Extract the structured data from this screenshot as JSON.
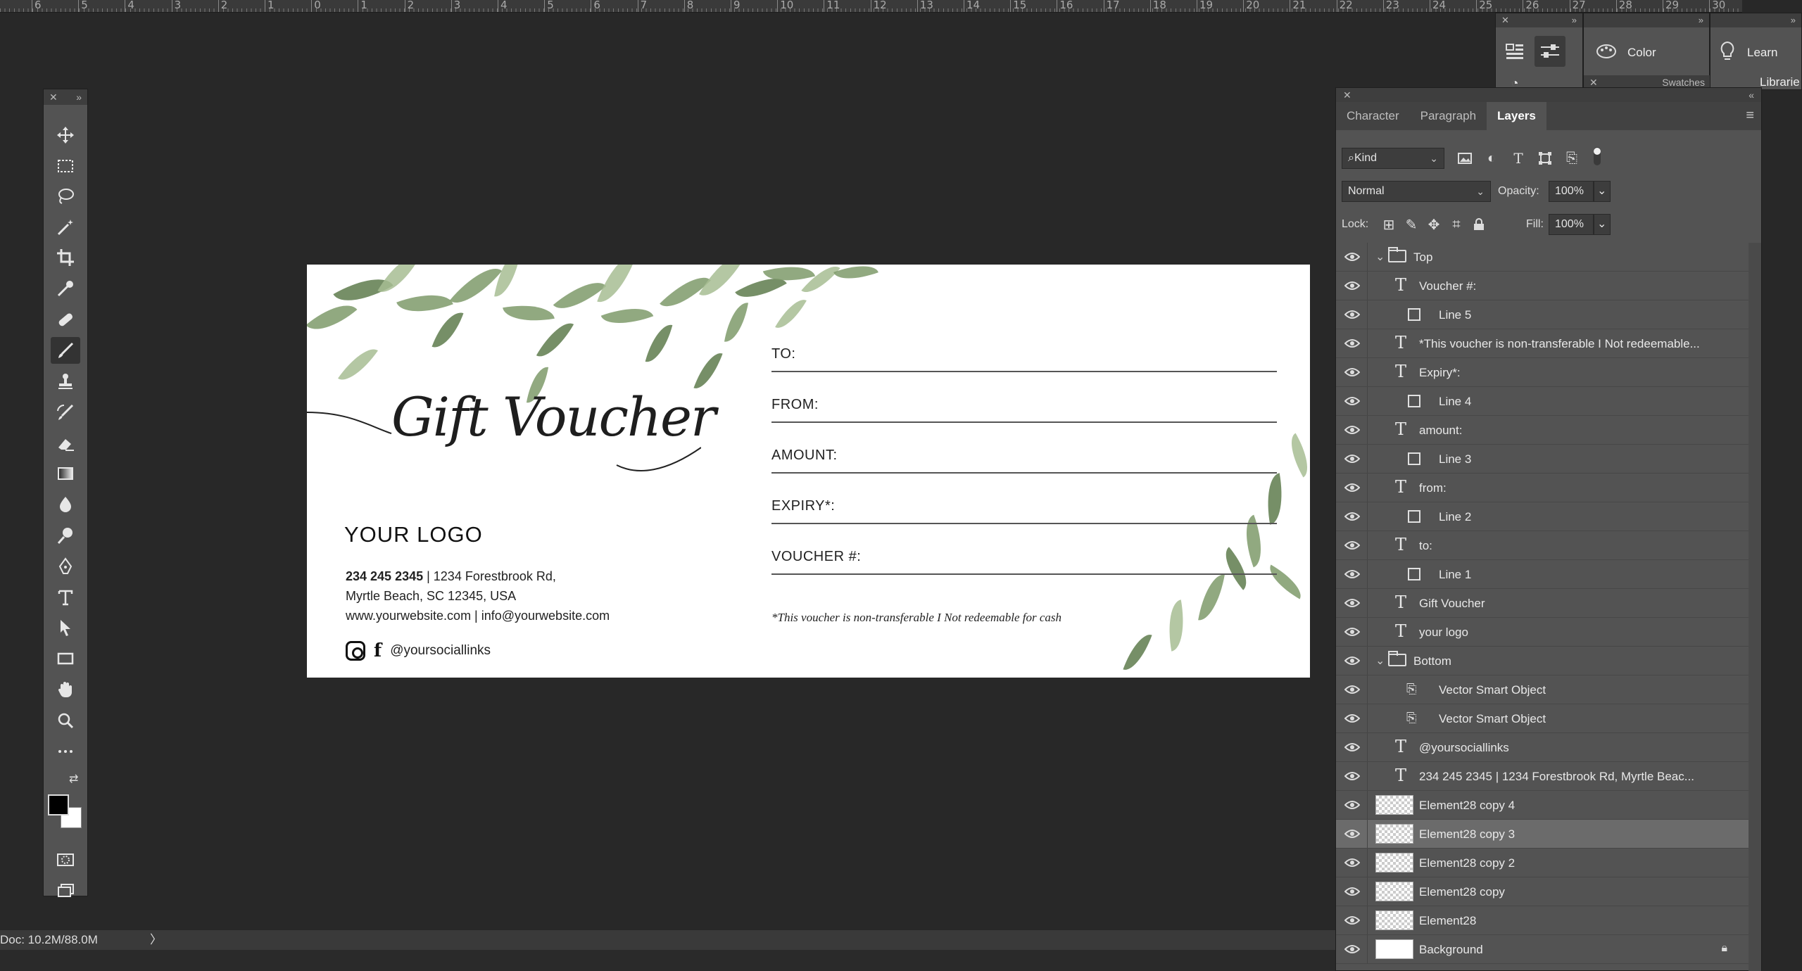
{
  "ruler": {
    "ticks": [
      "6",
      "5",
      "4",
      "3",
      "2",
      "1",
      "0",
      "1",
      "2",
      "3",
      "4",
      "5",
      "6",
      "7",
      "8",
      "9",
      "10",
      "11",
      "12",
      "13",
      "14",
      "15",
      "16",
      "17",
      "18",
      "19",
      "20",
      "21",
      "22",
      "23",
      "24",
      "25",
      "26",
      "27",
      "28",
      "29",
      "30"
    ]
  },
  "toolbar": {
    "close": "✕",
    "collapse": "»",
    "tools": [
      "move-tool",
      "marquee-tool",
      "lasso-tool",
      "magic-wand-tool",
      "crop-tool",
      "eyedropper-tool",
      "healing-brush-tool",
      "brush-tool",
      "clone-stamp-tool",
      "history-brush-tool",
      "eraser-tool",
      "gradient-tool",
      "blur-tool",
      "dodge-tool",
      "pen-tool",
      "type-tool",
      "path-selection-tool",
      "rectangle-tool",
      "hand-tool",
      "zoom-tool",
      "more-tools",
      "quick-mask",
      "screen-mode"
    ],
    "active_tool": "brush-tool",
    "more_label": "•••"
  },
  "status": {
    "doc": "Doc: 10.2M/88.0M",
    "arrow": "〉"
  },
  "voucher": {
    "title": "Gift Voucher",
    "logo": "YOUR LOGO",
    "phone": "234 245 2345",
    "address1": " | 1234 Forestbrook Rd,",
    "address2": "Myrtle Beach, SC 12345, USA",
    "web": "www.yourwebsite.com | info@yourwebsite.com",
    "social": "@yoursociallinks",
    "fields": [
      "TO:",
      "FROM:",
      "AMOUNT:",
      "EXPIRY*:",
      "VOUCHER #:"
    ],
    "disclaimer": "*This voucher is non-transferable I Not redeemable for cash"
  },
  "upper_panels": {
    "color_label": "Color",
    "learn_label": "Learn",
    "swatches_label": "Swatches",
    "libraries_label": "Librarie",
    "close": "✕",
    "collapse": "»"
  },
  "layers_panel": {
    "close": "✕",
    "collapse": "«",
    "tabs": [
      "Character",
      "Paragraph",
      "Layers"
    ],
    "active_tab": "Layers",
    "menu": "≡",
    "kind": "Kind",
    "blend_mode": "Normal",
    "opacity_label": "Opacity:",
    "opacity_value": "100%",
    "lock_label": "Lock:",
    "fill_label": "Fill:",
    "fill_value": "100%",
    "layers": [
      {
        "name": "Top",
        "kind": "group"
      },
      {
        "name": "Voucher #:",
        "kind": "text"
      },
      {
        "name": "Line 5",
        "kind": "shape"
      },
      {
        "name": "*This voucher is non-transferable I Not redeemable...",
        "kind": "text"
      },
      {
        "name": "Expiry*:",
        "kind": "text"
      },
      {
        "name": "Line 4",
        "kind": "shape"
      },
      {
        "name": "amount:",
        "kind": "text"
      },
      {
        "name": "Line 3",
        "kind": "shape"
      },
      {
        "name": "from:",
        "kind": "text"
      },
      {
        "name": "Line 2",
        "kind": "shape"
      },
      {
        "name": "to:",
        "kind": "text"
      },
      {
        "name": "Line 1",
        "kind": "shape"
      },
      {
        "name": "Gift Voucher",
        "kind": "text"
      },
      {
        "name": "your logo",
        "kind": "text"
      },
      {
        "name": "Bottom",
        "kind": "group"
      },
      {
        "name": "Vector Smart Object",
        "kind": "smart"
      },
      {
        "name": "Vector Smart Object",
        "kind": "smart"
      },
      {
        "name": "@yoursociallinks",
        "kind": "text"
      },
      {
        "name": "234 245 2345 | 1234 Forestbrook Rd,  Myrtle Beac...",
        "kind": "text"
      },
      {
        "name": "Element28 copy 4",
        "kind": "pixel"
      },
      {
        "name": "Element28 copy 3",
        "kind": "pixel",
        "selected": true
      },
      {
        "name": "Element28 copy 2",
        "kind": "pixel"
      },
      {
        "name": "Element28 copy",
        "kind": "pixel"
      },
      {
        "name": "Element28",
        "kind": "pixel"
      },
      {
        "name": "Background",
        "kind": "background"
      }
    ]
  }
}
